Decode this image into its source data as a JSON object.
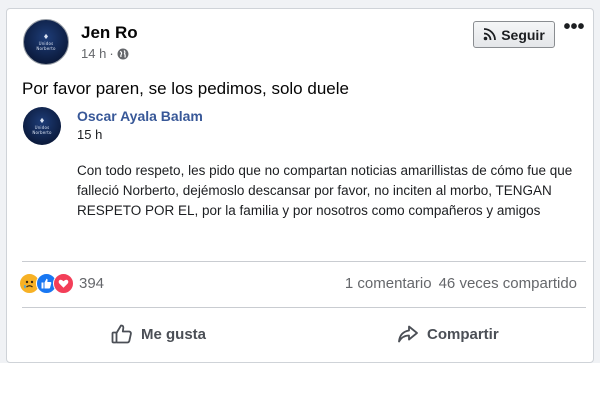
{
  "post": {
    "author": "Jen Ro",
    "time": "14 h",
    "separator": "·",
    "text": "Por favor paren, se los pedimos, solo duele",
    "follow_label": "Seguir",
    "more_label": "•••"
  },
  "avatar": {
    "text_line1": "Unidos",
    "text_line2": "Norberto"
  },
  "shared_post": {
    "author": "Oscar Ayala Balam",
    "time": "15 h",
    "body": "Con todo respeto, les pido que no compartan noticias amarillistas de cómo fue que falleció Norberto, dejémoslo descansar por favor, no inciten al morbo, TENGAN RESPETO POR EL, por la familia y por nosotros como compañeros y amigos"
  },
  "engagement": {
    "reaction_count": "394",
    "reactions": [
      "sad-emoji-icon",
      "like-icon",
      "love-icon"
    ],
    "comments": "1 comentario",
    "shares": "46 veces compartido"
  },
  "actions": {
    "like_label": "Me gusta",
    "share_label": "Compartir"
  },
  "colors": {
    "link_blue": "#385898",
    "like_blue": "#1877f2",
    "love_red": "#f33e58",
    "sad_yellow": "#f7b125",
    "muted": "#65676b"
  }
}
